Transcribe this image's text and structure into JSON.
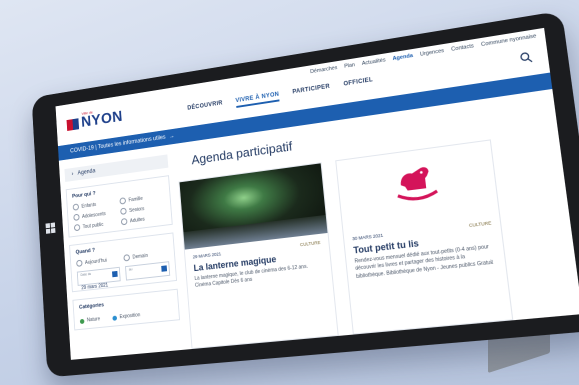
{
  "top_links": [
    "Démarches",
    "Plan",
    "Actualités",
    "Agenda",
    "Urgences",
    "Contacts",
    "Commune nyonnaise"
  ],
  "top_links_active_index": 3,
  "logo": {
    "small": "Ville de",
    "text": "NYON"
  },
  "nav": [
    "DÉCOUVRIR",
    "VIVRE À NYON",
    "PARTICIPER",
    "OFFICIEL"
  ],
  "nav_active_index": 1,
  "alert": {
    "text": "COVID-19 | Toutes les informations utiles",
    "arrow": "→"
  },
  "sidebar": {
    "head": {
      "chevron": "›",
      "label": "Agenda"
    },
    "pour_qui": {
      "title": "Pour qui ?",
      "options": [
        "Enfants",
        "Famille",
        "Adolescents",
        "Seniors",
        "Tout public",
        "Adultes"
      ]
    },
    "quand": {
      "title": "Quand ?",
      "options": [
        "Aujourd'hui",
        "Demain"
      ],
      "from": {
        "label": "Date du",
        "value": "29 mars 2021"
      },
      "to": {
        "label": "au",
        "value": ""
      }
    },
    "categories": {
      "title": "Catégories",
      "items": [
        {
          "label": "Nature",
          "color": "#3e9a4f"
        },
        {
          "label": "Exposition",
          "color": "#2b8fd0"
        }
      ]
    }
  },
  "main": {
    "title": "Agenda participatif",
    "cards": [
      {
        "date": "29 MARS 2021",
        "tag": "CULTURE",
        "title": "La lanterne magique",
        "desc": "La lanterne magique, le club de cinéma des 6-12 ans. Cinéma Capitole Dès 6 ans"
      },
      {
        "date": "30 MARS 2021",
        "tag": "CULTURE",
        "title": "Tout petit tu lis",
        "desc": "Rendez-vous mensuel dédié aux tout-petits (0-4 ans) pour découvrir les livres et partager des histoires à la bibliothèque. Bibliothèque de Nyon - Jeunes publics Gratuit"
      }
    ]
  },
  "colors": {
    "brand_blue": "#1d5fb0",
    "dark_blue": "#233a63",
    "accent_pink": "#d4145a",
    "logo_red": "#c8102e"
  }
}
